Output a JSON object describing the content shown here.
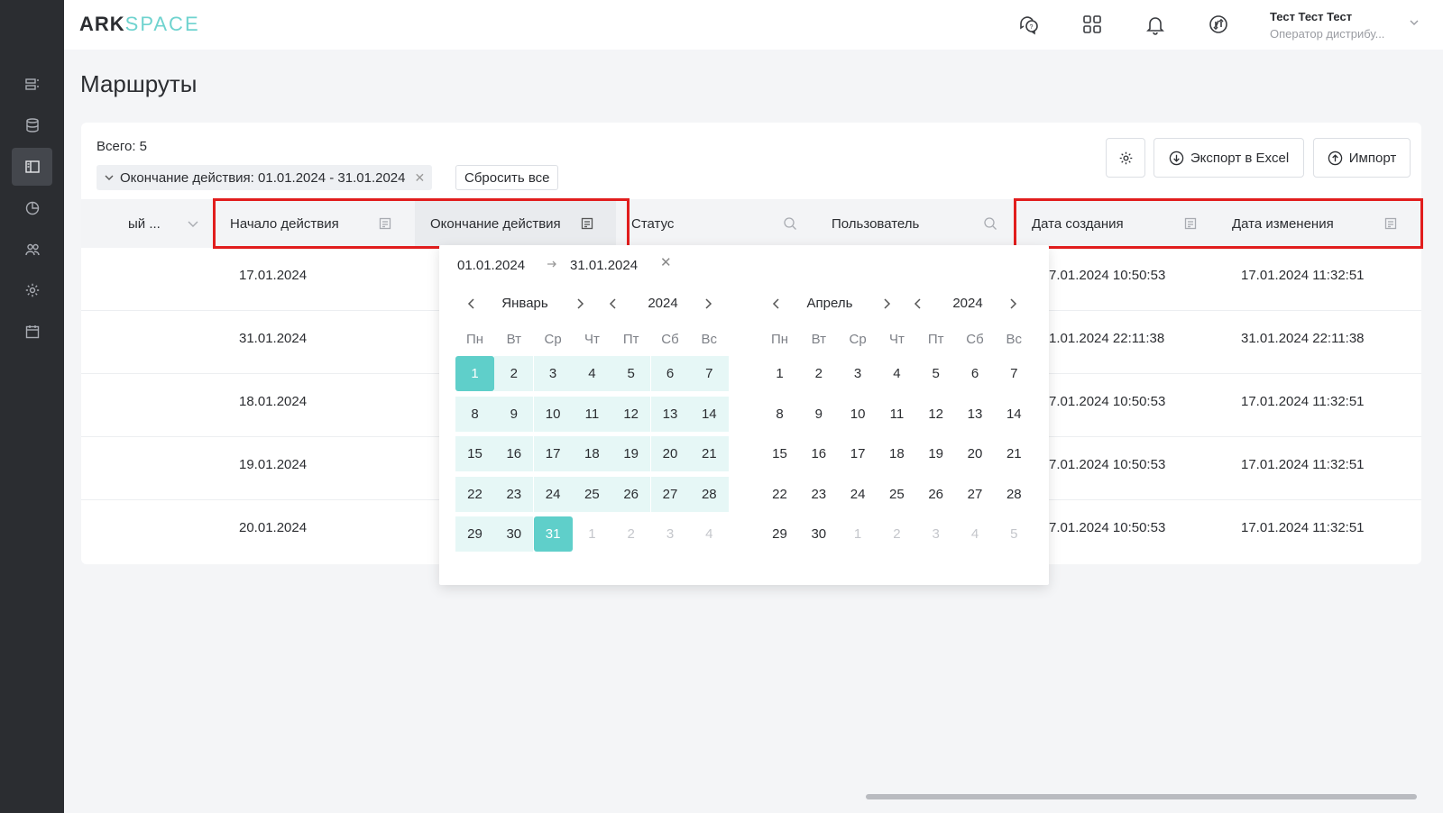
{
  "header": {
    "logo_part1": "ARK",
    "logo_part2": "SPACE",
    "user_name": "Тест Тест Тест",
    "user_role": "Оператор дистрибу..."
  },
  "page": {
    "title": "Маршруты",
    "total": "Всего: 5",
    "filter_chip": "Окончание действия: 01.01.2024 - 31.01.2024",
    "reset_label": "Сбросить все",
    "export_label": "Экспорт в Excel",
    "import_label": "Импорт"
  },
  "columns": [
    "ый ...",
    "Начало действия",
    "Окончание действия",
    "Статус",
    "Пользователь",
    "Дата создания",
    "Дата изменения"
  ],
  "rows": [
    {
      "start": "17.01.2024",
      "created": "7.01.2024 10:50:53",
      "modified": "17.01.2024 11:32:51"
    },
    {
      "start": "31.01.2024",
      "created": "1.01.2024 22:11:38",
      "modified": "31.01.2024 22:11:38"
    },
    {
      "start": "18.01.2024",
      "created": "7.01.2024 10:50:53",
      "modified": "17.01.2024 11:32:51"
    },
    {
      "start": "19.01.2024",
      "created": "7.01.2024 10:50:53",
      "modified": "17.01.2024 11:32:51"
    },
    {
      "start": "20.01.2024",
      "created": "7.01.2024 10:50:53",
      "modified": "17.01.2024 11:32:51"
    }
  ],
  "picker": {
    "from": "01.01.2024",
    "to": "31.01.2024",
    "weekdays": [
      "Пн",
      "Вт",
      "Ср",
      "Чт",
      "Пт",
      "Сб",
      "Вс"
    ],
    "left": {
      "month": "Январь",
      "year": "2024",
      "days": [
        "1",
        "2",
        "3",
        "4",
        "5",
        "6",
        "7",
        "8",
        "9",
        "10",
        "11",
        "12",
        "13",
        "14",
        "15",
        "16",
        "17",
        "18",
        "19",
        "20",
        "21",
        "22",
        "23",
        "24",
        "25",
        "26",
        "27",
        "28",
        "29",
        "30",
        "31",
        "1",
        "2",
        "3",
        "4"
      ]
    },
    "right": {
      "month": "Апрель",
      "year": "2024",
      "days": [
        "1",
        "2",
        "3",
        "4",
        "5",
        "6",
        "7",
        "8",
        "9",
        "10",
        "11",
        "12",
        "13",
        "14",
        "15",
        "16",
        "17",
        "18",
        "19",
        "20",
        "21",
        "22",
        "23",
        "24",
        "25",
        "26",
        "27",
        "28",
        "29",
        "30",
        "1",
        "2",
        "3",
        "4",
        "5"
      ]
    }
  },
  "colors": {
    "accent": "#5fcfca",
    "range_bg": "#e6f7f6",
    "highlight": "#e11d1d",
    "sidebar": "#2b2d31"
  }
}
